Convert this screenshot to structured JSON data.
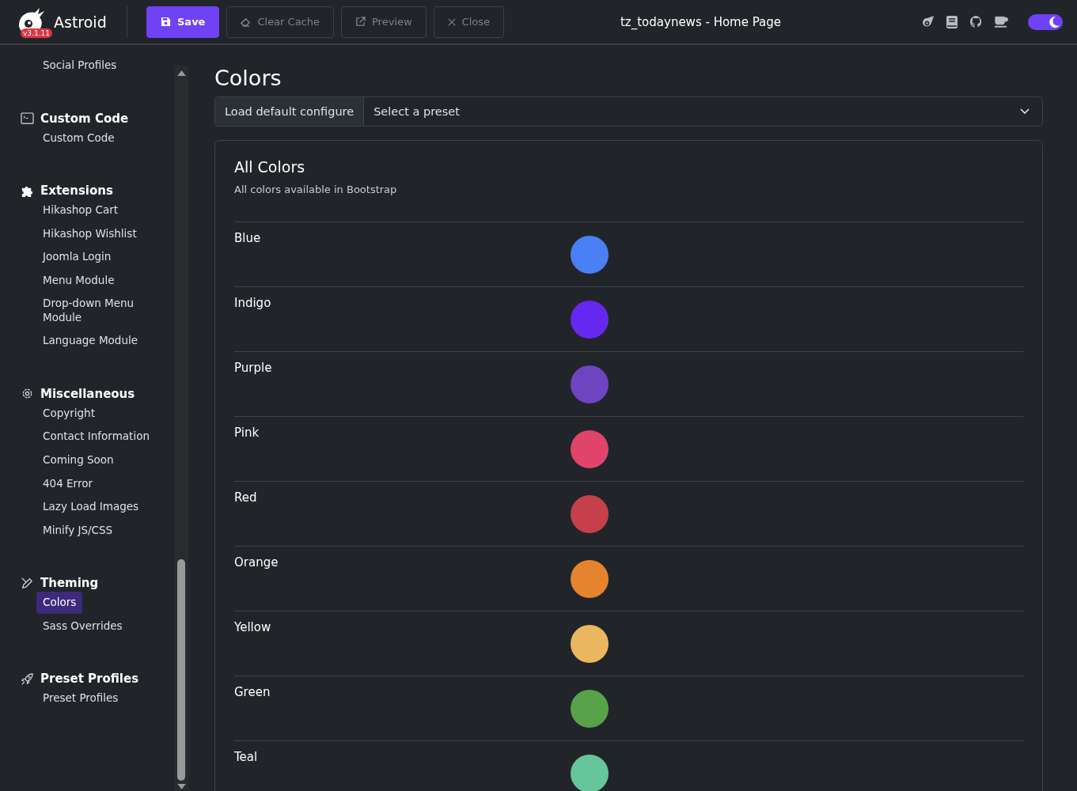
{
  "header": {
    "app_name": "Astroid",
    "version": "v3.1.11",
    "buttons": [
      {
        "label": "Save",
        "kind": "primary"
      },
      {
        "label": "Clear Cache",
        "kind": "outline"
      },
      {
        "label": "Preview",
        "kind": "outline"
      },
      {
        "label": "Close",
        "kind": "outline"
      }
    ],
    "title": "tz_todaynews - Home Page",
    "dark_mode": true
  },
  "sidebar": {
    "top_item": "Social Profiles",
    "sections": [
      {
        "title": "Custom Code",
        "items": [
          {
            "label": "Custom Code",
            "selected": false
          }
        ]
      },
      {
        "title": "Extensions",
        "items": [
          {
            "label": "Hikashop Cart",
            "selected": false
          },
          {
            "label": "Hikashop Wishlist",
            "selected": false
          },
          {
            "label": "Joomla Login",
            "selected": false
          },
          {
            "label": "Menu Module",
            "selected": false
          },
          {
            "label": "Drop-down Menu Module",
            "selected": false
          },
          {
            "label": "Language Module",
            "selected": false
          }
        ]
      },
      {
        "title": "Miscellaneous",
        "items": [
          {
            "label": "Copyright",
            "selected": false
          },
          {
            "label": "Contact Information",
            "selected": false
          },
          {
            "label": "Coming Soon",
            "selected": false
          },
          {
            "label": "404 Error",
            "selected": false
          },
          {
            "label": "Lazy Load Images",
            "selected": false
          },
          {
            "label": "Minify JS/CSS",
            "selected": false
          }
        ]
      },
      {
        "title": "Theming",
        "items": [
          {
            "label": "Colors",
            "selected": true
          },
          {
            "label": "Sass Overrides",
            "selected": false
          }
        ]
      },
      {
        "title": "Preset Profiles",
        "items": [
          {
            "label": "Preset Profiles",
            "selected": false
          }
        ]
      }
    ]
  },
  "main": {
    "title": "Colors",
    "load_button": "Load default configure",
    "preset_select": "Select a preset",
    "card": {
      "title": "All Colors",
      "subtitle": "All colors available in Bootstrap",
      "colors": [
        {
          "name": "Blue",
          "color": "#4a80f5"
        },
        {
          "name": "Indigo",
          "color": "#6528f0"
        },
        {
          "name": "Purple",
          "color": "#6d45c1"
        },
        {
          "name": "Pink",
          "color": "#e0446a"
        },
        {
          "name": "Red",
          "color": "#c5404a"
        },
        {
          "name": "Orange",
          "color": "#e6832f"
        },
        {
          "name": "Yellow",
          "color": "#ebb660"
        },
        {
          "name": "Green",
          "color": "#58a24a"
        },
        {
          "name": "Teal",
          "color": "#66c69b"
        }
      ]
    }
  }
}
